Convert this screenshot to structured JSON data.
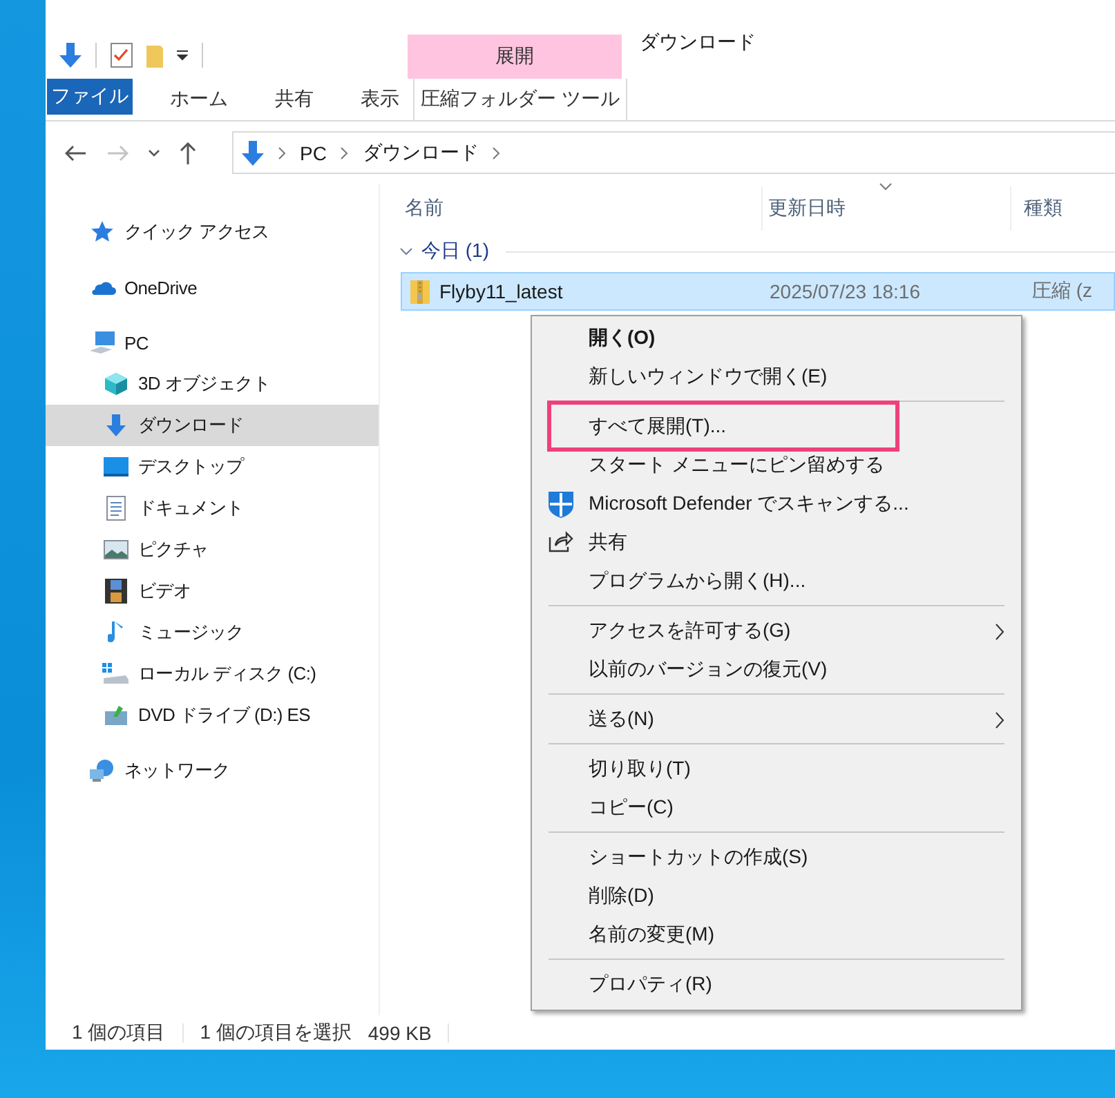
{
  "window": {
    "title": "ダウンロード"
  },
  "ribbon": {
    "context_group": "展開",
    "tabs": [
      {
        "label": "ファイル",
        "kind": "file",
        "selected": false
      },
      {
        "label": "ホーム",
        "kind": "normal",
        "selected": false
      },
      {
        "label": "共有",
        "kind": "normal",
        "selected": false
      },
      {
        "label": "表示",
        "kind": "normal",
        "selected": false
      },
      {
        "label": "圧縮フォルダー ツール",
        "kind": "context",
        "selected": false
      }
    ]
  },
  "address_bar": {
    "path": [
      "PC",
      "ダウンロード"
    ]
  },
  "navigation": {
    "items": [
      {
        "label": "クイック アクセス",
        "selected": false
      },
      {
        "label": "OneDrive",
        "selected": false
      },
      {
        "label": "PC",
        "selected": false,
        "children": [
          {
            "label": "3D オブジェクト",
            "selected": false
          },
          {
            "label": "ダウンロード",
            "selected": true
          },
          {
            "label": "デスクトップ",
            "selected": false
          },
          {
            "label": "ドキュメント",
            "selected": false
          },
          {
            "label": "ピクチャ",
            "selected": false
          },
          {
            "label": "ビデオ",
            "selected": false
          },
          {
            "label": "ミュージック",
            "selected": false
          },
          {
            "label": "ローカル ディスク (C:)",
            "selected": false
          },
          {
            "label": "DVD ドライブ (D:) ES",
            "selected": false
          }
        ]
      },
      {
        "label": "ネットワーク",
        "selected": false
      }
    ]
  },
  "file_list": {
    "columns": [
      "名前",
      "更新日時",
      "種類"
    ],
    "groups": [
      {
        "label": "今日 (1)",
        "expanded": true,
        "files": [
          {
            "name": "Flyby11_latest",
            "modified": "2025/07/23 18:16",
            "type": "圧縮 (z",
            "selected": true
          }
        ]
      }
    ]
  },
  "context_menu": {
    "items": [
      {
        "kind": "item",
        "label": "開く(O)",
        "default": true,
        "highlighted": false,
        "submenu": false
      },
      {
        "kind": "item",
        "label": "新しいウィンドウで開く(E)",
        "default": false,
        "highlighted": false,
        "submenu": false
      },
      {
        "kind": "separator"
      },
      {
        "kind": "item",
        "label": "すべて展開(T)...",
        "default": false,
        "highlighted": true,
        "submenu": false
      },
      {
        "kind": "item",
        "label": "スタート メニューにピン留めする",
        "default": false,
        "highlighted": false,
        "submenu": false
      },
      {
        "kind": "defender",
        "label": "Microsoft Defender でスキャンする...",
        "default": false,
        "highlighted": false,
        "submenu": false
      },
      {
        "kind": "share",
        "label": "共有",
        "default": false,
        "highlighted": false,
        "submenu": false
      },
      {
        "kind": "item",
        "label": "プログラムから開く(H)...",
        "default": false,
        "highlighted": false,
        "submenu": false
      },
      {
        "kind": "separator"
      },
      {
        "kind": "item",
        "label": "アクセスを許可する(G)",
        "default": false,
        "highlighted": false,
        "submenu": true
      },
      {
        "kind": "item",
        "label": "以前のバージョンの復元(V)",
        "default": false,
        "highlighted": false,
        "submenu": false
      },
      {
        "kind": "separator"
      },
      {
        "kind": "item",
        "label": "送る(N)",
        "default": false,
        "highlighted": false,
        "submenu": true
      },
      {
        "kind": "separator"
      },
      {
        "kind": "item",
        "label": "切り取り(T)",
        "default": false,
        "highlighted": false,
        "submenu": false
      },
      {
        "kind": "item",
        "label": "コピー(C)",
        "default": false,
        "highlighted": false,
        "submenu": false
      },
      {
        "kind": "separator"
      },
      {
        "kind": "item",
        "label": "ショートカットの作成(S)",
        "default": false,
        "highlighted": false,
        "submenu": false
      },
      {
        "kind": "item",
        "label": "削除(D)",
        "default": false,
        "highlighted": false,
        "submenu": false
      },
      {
        "kind": "item",
        "label": "名前の変更(M)",
        "default": false,
        "highlighted": false,
        "submenu": false
      },
      {
        "kind": "separator"
      },
      {
        "kind": "item",
        "label": "プロパティ(R)",
        "default": false,
        "highlighted": false,
        "submenu": false
      }
    ]
  },
  "status_bar": {
    "item_count": "1 個の項目",
    "selection": "1 個の項目を選択",
    "size": "499 KB"
  }
}
